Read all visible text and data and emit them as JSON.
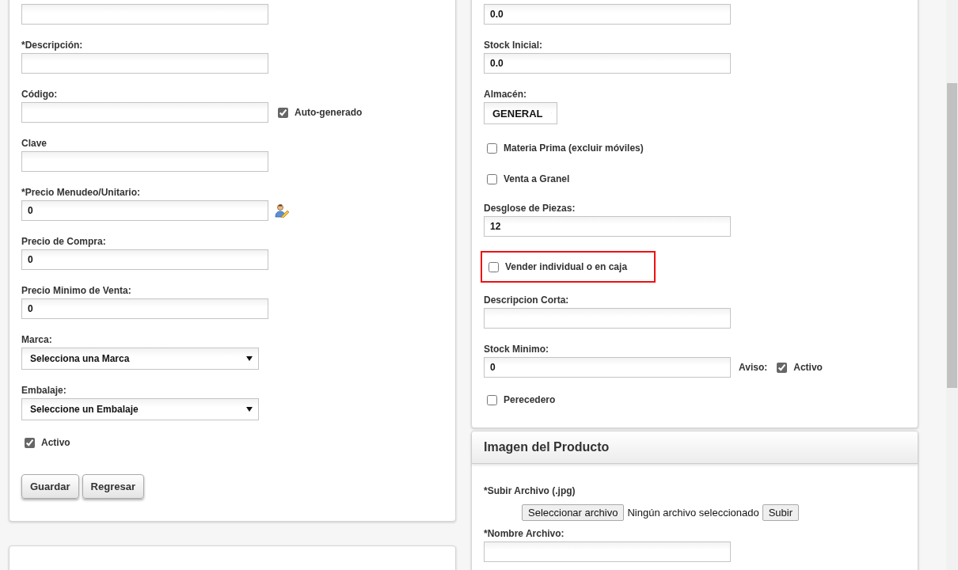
{
  "product_form": {
    "fields": [
      {
        "kind": "input"
      },
      {
        "kind": "input",
        "label": "*Descripción:"
      },
      {
        "kind": "input",
        "label": "Código:",
        "checkbox": {
          "label": "Auto-generado",
          "checked": true
        }
      },
      {
        "kind": "input",
        "label": "Clave"
      },
      {
        "kind": "input-icon",
        "label": "*Precio Menudeo/Unitario:",
        "value": "0"
      },
      {
        "kind": "input",
        "label": "Precio de Compra:",
        "value": "0"
      },
      {
        "kind": "input",
        "label": "Precio Minimo de Venta:",
        "value": "0"
      },
      {
        "kind": "select",
        "label": "Marca:",
        "value": "Selecciona una Marca"
      },
      {
        "kind": "select",
        "label": "Embalaje:",
        "value": "Seleccione un Embalaje"
      },
      {
        "kind": "checkbox",
        "label": "Activo",
        "checked": true
      }
    ],
    "buttons": [
      "Guardar",
      "Regresar"
    ]
  },
  "inventory": {
    "fields": [
      {
        "kind": "input",
        "value": "0.0"
      },
      {
        "kind": "input",
        "label": "Stock Inicial:",
        "value": "0.0"
      },
      {
        "kind": "small-select",
        "label": "Almacén:",
        "value": "GENERAL"
      },
      {
        "kind": "checkbox",
        "label": "Materia Prima (excluir móviles)",
        "checked": false
      },
      {
        "kind": "checkbox",
        "label": "Venta a Granel",
        "checked": false
      },
      {
        "kind": "input",
        "label": "Desglose de Piezas:",
        "value": "12"
      },
      {
        "kind": "checkbox",
        "label": "Vender individual o en caja",
        "checked": false,
        "highlighted": true
      },
      {
        "kind": "input",
        "label": "Descripcion Corta:"
      },
      {
        "kind": "input",
        "label": "Stock Minimo:",
        "value": "0",
        "aviso": {
          "label": "Aviso:",
          "checkbox": {
            "label": "Activo",
            "checked": true
          }
        }
      },
      {
        "kind": "checkbox",
        "label": "Perecedero",
        "checked": false
      }
    ]
  },
  "image_panel": {
    "title": "Imagen del Producto",
    "upload": {
      "label": "*Subir Archivo (.jpg)",
      "choose_button": "Seleccionar archivo",
      "status": "Ningún archivo seleccionado",
      "submit_button": "Subir"
    },
    "name_field": {
      "label": "*Nombre Archivo:"
    }
  }
}
